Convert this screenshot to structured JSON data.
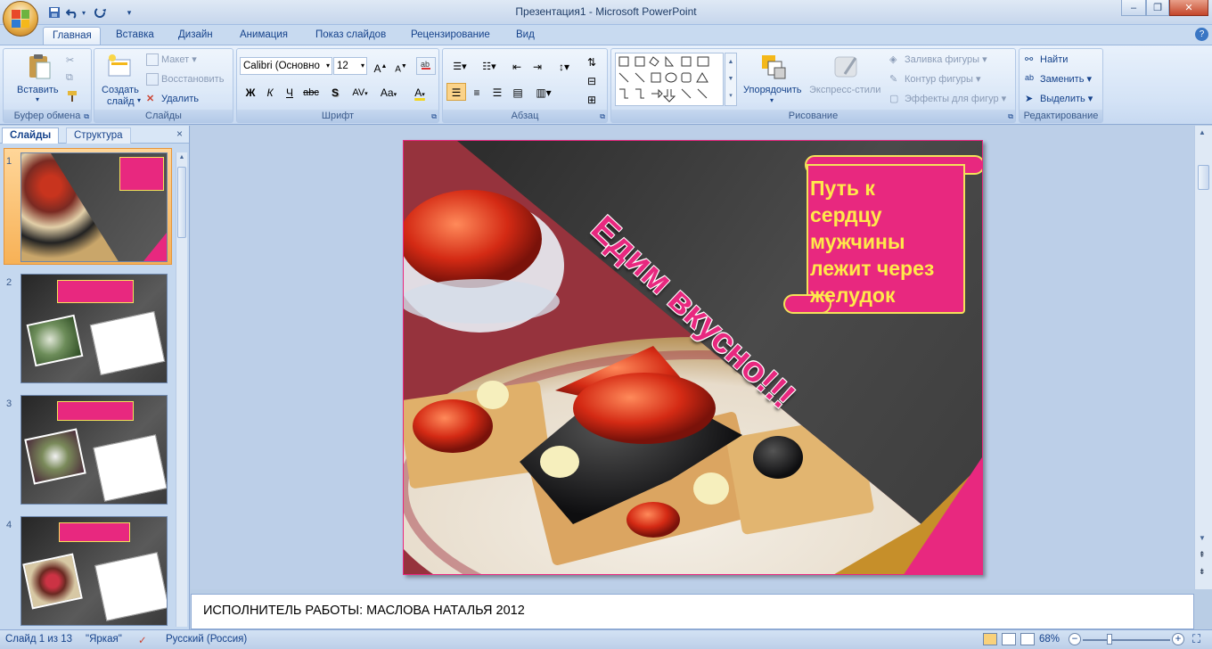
{
  "window": {
    "title": "Презентация1 - Microsoft PowerPoint",
    "controls": [
      "–",
      "❐",
      "✕"
    ]
  },
  "quick_access": {
    "save": "save-icon",
    "undo": "undo-icon",
    "redo": "redo-icon",
    "customize": "▾"
  },
  "ribbon_tabs": [
    "Главная",
    "Вставка",
    "Дизайн",
    "Анимация",
    "Показ слайдов",
    "Рецензирование",
    "Вид"
  ],
  "active_tab": "Главная",
  "groups": {
    "clipboard": {
      "label": "Буфер обмена",
      "paste": "Вставить"
    },
    "slides": {
      "label": "Слайды",
      "new_slide_line1": "Создать",
      "new_slide_line2": "слайд",
      "layout": "Макет",
      "reset": "Восстановить",
      "delete": "Удалить"
    },
    "font": {
      "label": "Шрифт",
      "font_name": "Calibri (Основно",
      "font_size": "12",
      "bold": "Ж",
      "italic": "К",
      "underline": "Ч",
      "strike": "abc",
      "shadow": "S",
      "spacing": "AV",
      "case": "Aa",
      "color": "A"
    },
    "paragraph": {
      "label": "Абзац"
    },
    "drawing": {
      "label": "Рисование",
      "arrange": "Упорядочить",
      "quick_styles": "Экспресс-стили",
      "fill": "Заливка фигуры",
      "outline": "Контур фигуры",
      "effects": "Эффекты для фигур"
    },
    "editing": {
      "label": "Редактирование",
      "find": "Найти",
      "replace": "Заменить",
      "select": "Выделить"
    }
  },
  "left_pane": {
    "tabs": [
      "Слайды",
      "Структура"
    ],
    "close": "×",
    "thumbnails": [
      {
        "num": "1"
      },
      {
        "num": "2"
      },
      {
        "num": "3"
      },
      {
        "num": "4"
      }
    ]
  },
  "slide": {
    "banner_text_lines": [
      "Путь к",
      "сердцу",
      "мужчины",
      "лежит через",
      "желудок"
    ],
    "diagonal_text": "Едим вкусно!!!",
    "colors": {
      "pink": "#e8287f",
      "yellow": "#ffe94a"
    }
  },
  "notes": {
    "text": "ИСПОЛНИТЕЛЬ РАБОТЫ: МАСЛОВА НАТАЛЬЯ 2012"
  },
  "status_bar": {
    "slide_info": "Слайд 1 из 13",
    "theme": "\"Яркая\"",
    "language": "Русский (Россия)",
    "zoom": "68%"
  }
}
